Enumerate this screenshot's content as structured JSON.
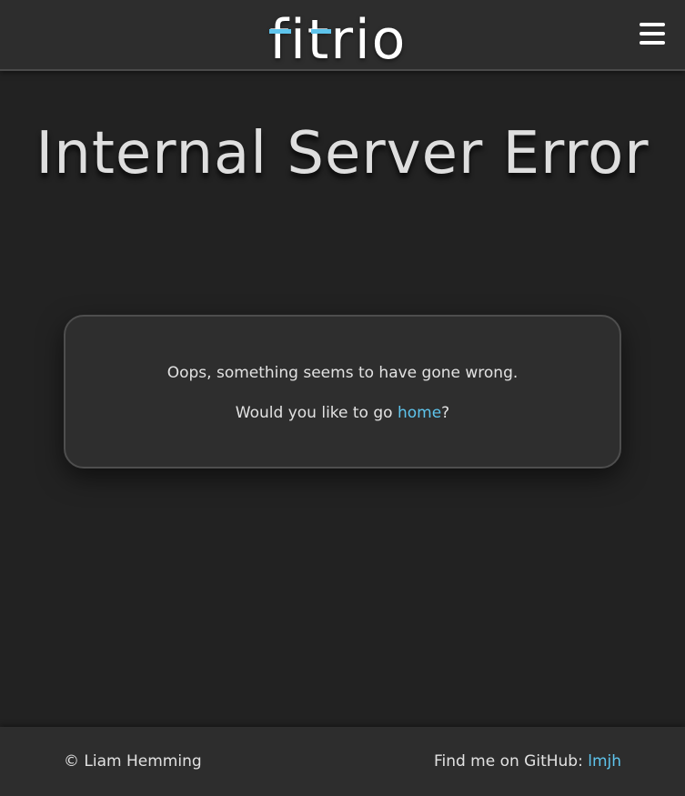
{
  "header": {
    "logo_text": "fitrio",
    "menu_icon": "hamburger-menu-icon"
  },
  "main": {
    "title": "Internal Server Error",
    "message": "Oops, something seems to have gone wrong.",
    "home_prompt_before": "Would you like to go ",
    "home_link": "home",
    "home_prompt_after": "?"
  },
  "footer": {
    "copyright": "© Liam Hemming",
    "github_label": "Find me on GitHub: ",
    "github_link": "lmjh"
  },
  "colors": {
    "accent": "#5ec4ec",
    "background": "#222222",
    "surface": "#2d2d2d"
  }
}
